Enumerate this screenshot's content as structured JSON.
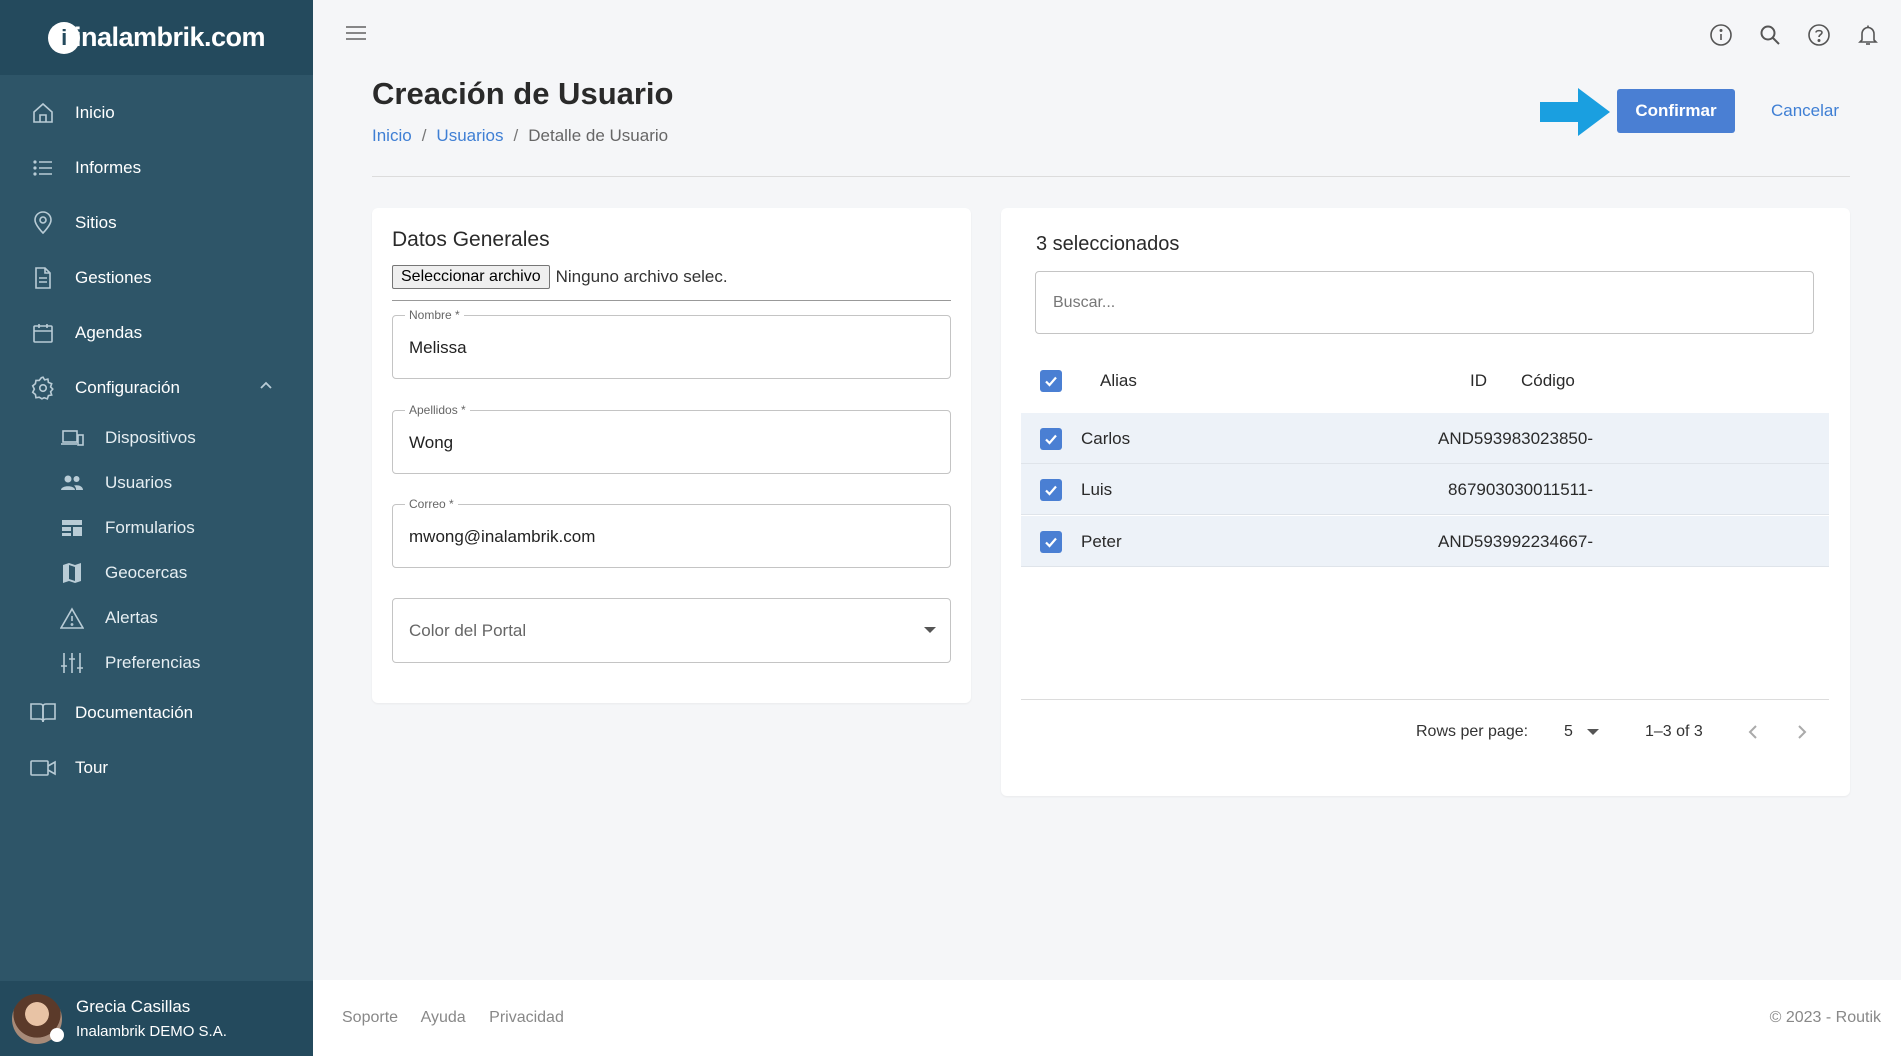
{
  "brand": {
    "logo_text": "inalambrik.com"
  },
  "sidebar": {
    "items": [
      {
        "label": "Inicio",
        "icon": "home-icon"
      },
      {
        "label": "Informes",
        "icon": "list-icon"
      },
      {
        "label": "Sitios",
        "icon": "map-pin-icon"
      },
      {
        "label": "Gestiones",
        "icon": "document-icon"
      },
      {
        "label": "Agendas",
        "icon": "calendar-icon"
      },
      {
        "label": "Configuración",
        "icon": "gear-icon",
        "expanded": true
      }
    ],
    "subitems": [
      {
        "label": "Dispositivos",
        "icon": "devices-icon"
      },
      {
        "label": "Usuarios",
        "icon": "users-icon"
      },
      {
        "label": "Formularios",
        "icon": "forms-icon"
      },
      {
        "label": "Geocercas",
        "icon": "map-icon"
      },
      {
        "label": "Alertas",
        "icon": "warning-icon"
      },
      {
        "label": "Preferencias",
        "icon": "sliders-icon"
      }
    ],
    "bottom_items": [
      {
        "label": "Documentación",
        "icon": "book-icon"
      },
      {
        "label": "Tour",
        "icon": "video-icon"
      }
    ],
    "user": {
      "name": "Grecia Casillas",
      "org": "Inalambrik DEMO S.A."
    }
  },
  "header": {
    "title": "Creación de Usuario",
    "breadcrumb": [
      "Inicio",
      "Usuarios",
      "Detalle de Usuario"
    ],
    "confirm_label": "Confirmar",
    "cancel_label": "Cancelar"
  },
  "form": {
    "section_title": "Datos Generales",
    "file_button": "Seleccionar archivo",
    "file_status": "Ninguno archivo selec.",
    "fields": [
      {
        "label": "Nombre *",
        "value": "Melissa"
      },
      {
        "label": "Apellidos *",
        "value": "Wong"
      },
      {
        "label": "Correo *",
        "value": "mwong@inalambrik.com"
      }
    ],
    "color_placeholder": "Color del Portal"
  },
  "devices": {
    "selected_text": "3 seleccionados",
    "search_placeholder": "Buscar...",
    "columns": [
      "Alias",
      "ID",
      "Código"
    ],
    "rows": [
      {
        "alias": "Carlos",
        "id": "AND593983023850-",
        "checked": true
      },
      {
        "alias": "Luis",
        "id": "867903030011511-",
        "checked": true
      },
      {
        "alias": "Peter",
        "id": "AND593992234667-",
        "checked": true
      }
    ],
    "rows_per_page_label": "Rows per page:",
    "rows_per_page": "5",
    "range": "1–3 of 3"
  },
  "footer": {
    "links": [
      "Soporte",
      "Ayuda",
      "Privacidad"
    ],
    "copyright": "© 2023 - Routik"
  },
  "colors": {
    "sidebar": "#2e5568",
    "sidebar_dark": "#244a5d",
    "accent": "#4a7fd3",
    "link": "#3f7fd4",
    "arrow": "#1a9fe0"
  }
}
